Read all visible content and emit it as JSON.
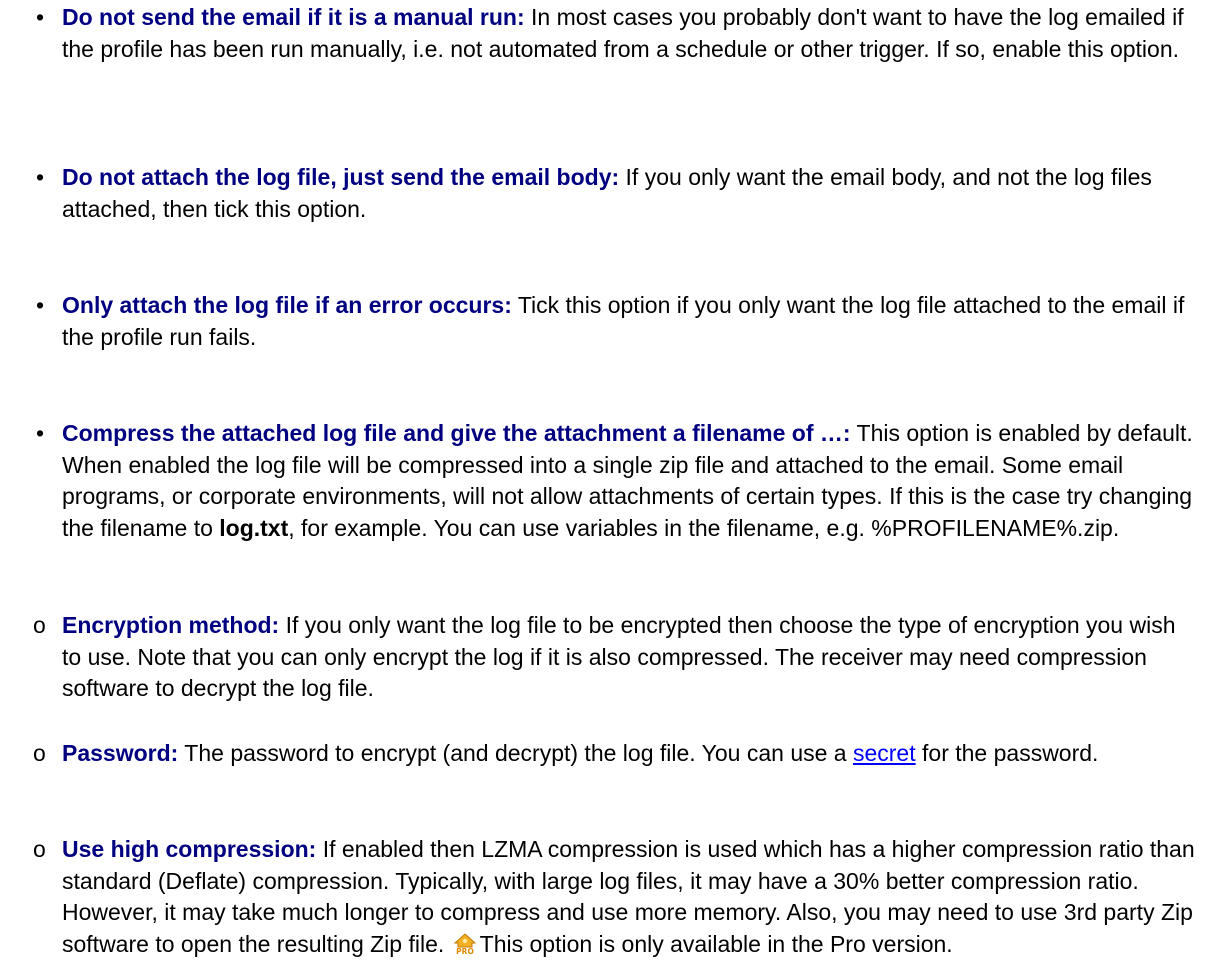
{
  "items": [
    {
      "term": "Do not send the email if it is a manual run:",
      "text": " In most cases you probably don't want to have the log emailed if the profile has been run manually, i.e. not automated from a schedule or other trigger. If so, enable this option."
    },
    {
      "term": "Do not attach the log file, just send the email body:",
      "text": " If you only want the email body, and not the log files attached, then tick this option."
    },
    {
      "term": "Only attach the log file if an error occurs:",
      "text": " Tick this option if you only want the log file attached to the email if the profile run fails."
    },
    {
      "term": "Compress the attached log file and give the attachment a filename of …:",
      "text_a": " This option is enabled by default. When enabled the log file will be compressed into a single zip file and attached to the email. Some email programs, or corporate environments, will not allow attachments of certain types. If this is the case try changing the filename to ",
      "bold_name": "log.txt",
      "text_b": ", for example. You can use variables in the filename, e.g. %PROFILENAME%.zip."
    }
  ],
  "subitems": [
    {
      "marker": "o",
      "term": "Encryption method:",
      "text": " If you only want the log file to be encrypted then choose the type of encryption you wish to use. Note that you can only encrypt the log if it is also compressed. The receiver may need compression software to decrypt the log file."
    },
    {
      "marker": "o",
      "term": "Password:",
      "text_a": " The password to encrypt (and decrypt) the log file. You can use a ",
      "link": "secret",
      "text_b": " for the password."
    },
    {
      "marker": "o",
      "term": "Use high compression:",
      "text_a": " If enabled then LZMA compression is used which has a higher compression ratio than standard (Deflate) compression. Typically, with large log files, it may have a 30% better compression ratio. However, it may take much longer to compress and use more memory. Also, you may need to use 3rd party Zip software to open the resulting Zip file.",
      "icon": "pro-icon",
      "text_b": "This option is only available in the Pro version."
    }
  ],
  "colors": {
    "term": "#000080",
    "link": "#0000ff",
    "text": "#000000"
  }
}
